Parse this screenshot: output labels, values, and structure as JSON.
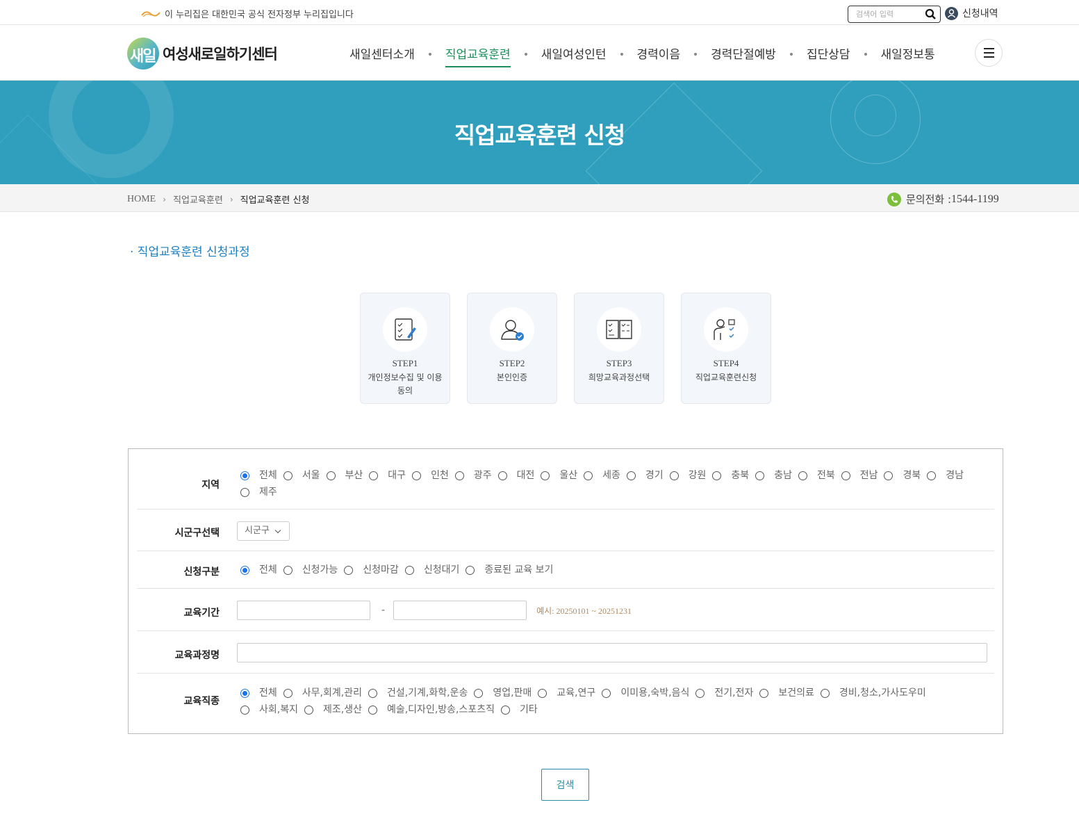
{
  "gov_bar": {
    "notice": "이 누리집은 대한민국 공식 전자정부 누리집입니다",
    "search_placeholder": "검색어 입력",
    "apply_history": "신청내역"
  },
  "header": {
    "logo_mark": "새일",
    "logo_text": "여성새로일하기센터",
    "nav": [
      "새일센터소개",
      "직업교육훈련",
      "새일여성인턴",
      "경력이음",
      "경력단절예방",
      "집단상담",
      "새일정보통"
    ],
    "active_nav": "직업교육훈련"
  },
  "banner": {
    "title": "직업교육훈련 신청"
  },
  "breadcrumb": {
    "items": [
      "HOME",
      "직업교육훈련",
      "직업교육훈련 신청"
    ],
    "phone_label": "문의전화 : ",
    "phone_number": "1544-1199"
  },
  "section_title": "· 직업교육훈련 신청과정",
  "steps": [
    {
      "num": "STEP1",
      "name": "개인정보수집 및 이용동의"
    },
    {
      "num": "STEP2",
      "name": "본인인증"
    },
    {
      "num": "STEP3",
      "name": "희망교육과정선택"
    },
    {
      "num": "STEP4",
      "name": "직업교육훈련신청"
    }
  ],
  "form": {
    "region": {
      "label": "지역",
      "options": [
        "전체",
        "서울",
        "부산",
        "대구",
        "인천",
        "광주",
        "대전",
        "울산",
        "세종",
        "경기",
        "강원",
        "충북",
        "충남",
        "전북",
        "전남",
        "경북",
        "경남",
        "제주"
      ],
      "selected": "전체"
    },
    "district": {
      "label": "시군구선택",
      "value": "시군구"
    },
    "status": {
      "label": "신청구분",
      "options": [
        "전체",
        "신청가능",
        "신청마감",
        "신청대기",
        "종료된 교육 보기"
      ],
      "selected": "전체"
    },
    "period": {
      "label": "교육기간",
      "start": "",
      "end": "",
      "separator": "-",
      "hint": "예시: 20250101 ~ 20251231"
    },
    "course_name": {
      "label": "교육과정명",
      "value": ""
    },
    "job_type": {
      "label": "교육직종",
      "options": [
        "전체",
        "사무,회계,관리",
        "건설,기계,화학,운송",
        "영업,판매",
        "교육,연구",
        "이미용,숙박,음식",
        "전기,전자",
        "보건의료",
        "경비,청소,가사도우미",
        "사회,복지",
        "제조,생산",
        "예술,디자인,방송,스포츠직",
        "기타"
      ],
      "selected": "전체"
    }
  },
  "submit_label": "검색",
  "colors": {
    "banner": "#2f9fbd",
    "active_nav": "#1a8f5a",
    "section_title": "#1b7fc1",
    "button": "#2a8fa6"
  }
}
